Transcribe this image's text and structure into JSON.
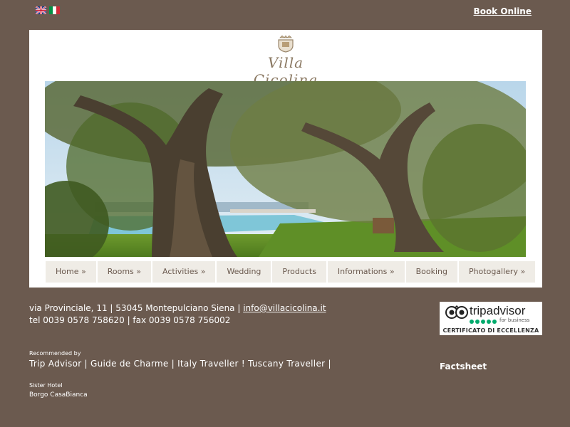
{
  "header": {
    "languages": [
      {
        "code": "en",
        "icon": "uk-flag-icon"
      },
      {
        "code": "it",
        "icon": "italy-flag-icon",
        "colors": [
          "#009246",
          "#ffffff",
          "#ce2b37"
        ]
      }
    ],
    "book_online": "Book Online"
  },
  "brand": {
    "name": "Villa Cicolina",
    "crest_icon": "crest-icon",
    "accent": "#8a7862"
  },
  "hero": {
    "icon": "olive-trees-pool-photo"
  },
  "nav": {
    "items": [
      {
        "label": "Home »"
      },
      {
        "label": "Rooms »"
      },
      {
        "label": "Activities »"
      },
      {
        "label": "Wedding"
      },
      {
        "label": "Products"
      },
      {
        "label": "Informations »"
      },
      {
        "label": "Booking"
      },
      {
        "label": "Photogallery »"
      }
    ]
  },
  "contact": {
    "address": "via Provinciale, 11 | 53045 Montepulciano Siena | ",
    "email": "info@villacicolina.it",
    "phone_line": "tel 0039 0578 758620 | fax 0039 0578 756002"
  },
  "tripadvisor": {
    "brand": "tripadvisor",
    "sub": "for business",
    "certificate": "CERTIFICATO DI ECCELLENZA",
    "icon": "tripadvisor-owl-icon",
    "accent": "#00aa6c"
  },
  "recommended": {
    "label": "Recommended by",
    "list": "Trip Advisor | Guide de Charme | Italy Traveller ! Tuscany Traveller |"
  },
  "factsheet": "Factsheet",
  "sister": {
    "label": "Sister Hotel",
    "name": "Borgo CasaBianca"
  },
  "colors": {
    "background": "#6b5a4f",
    "nav_bg": "#efece6",
    "nav_text": "#6b5a4f"
  }
}
